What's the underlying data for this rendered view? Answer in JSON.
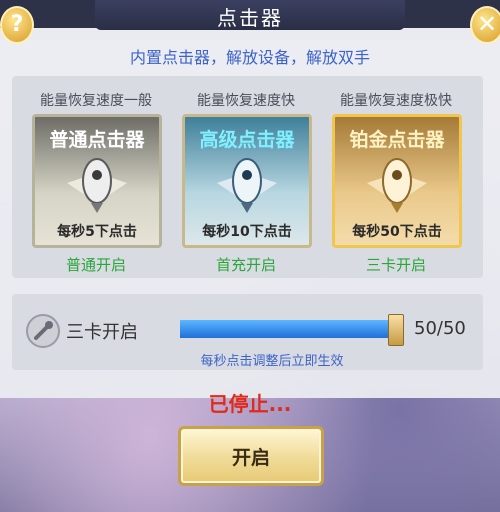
{
  "window": {
    "title": "点击器",
    "help_icon": "help-icon",
    "close_icon": "close-icon"
  },
  "subtitle": "内置点击器，解放设备，解放双手",
  "tiers": [
    {
      "speed_label": "能量恢复速度一般",
      "name": "普通点击器",
      "rate": "每秒5下点击",
      "unlock": "普通开启",
      "icon": "rocket-wings-icon"
    },
    {
      "speed_label": "能量恢复速度快",
      "name": "高级点击器",
      "rate": "每秒10下点击",
      "unlock": "首充开启",
      "icon": "rocket-wings-icon"
    },
    {
      "speed_label": "能量恢复速度极快",
      "name": "铂金点击器",
      "rate": "每秒50下点击",
      "unlock": "三卡开启",
      "icon": "rocket-wings-icon"
    }
  ],
  "slider": {
    "mode_label": "三卡开启",
    "value": 50,
    "max": 50,
    "count_text": "50/50",
    "hint": "每秒点击调整后立即生效",
    "icon": "rocket-icon"
  },
  "status": "已停止...",
  "start_button": "开启",
  "colors": {
    "accent_blue": "#3b63c9",
    "unlock_green": "#2aa63a",
    "status_red": "#e02a1a"
  }
}
